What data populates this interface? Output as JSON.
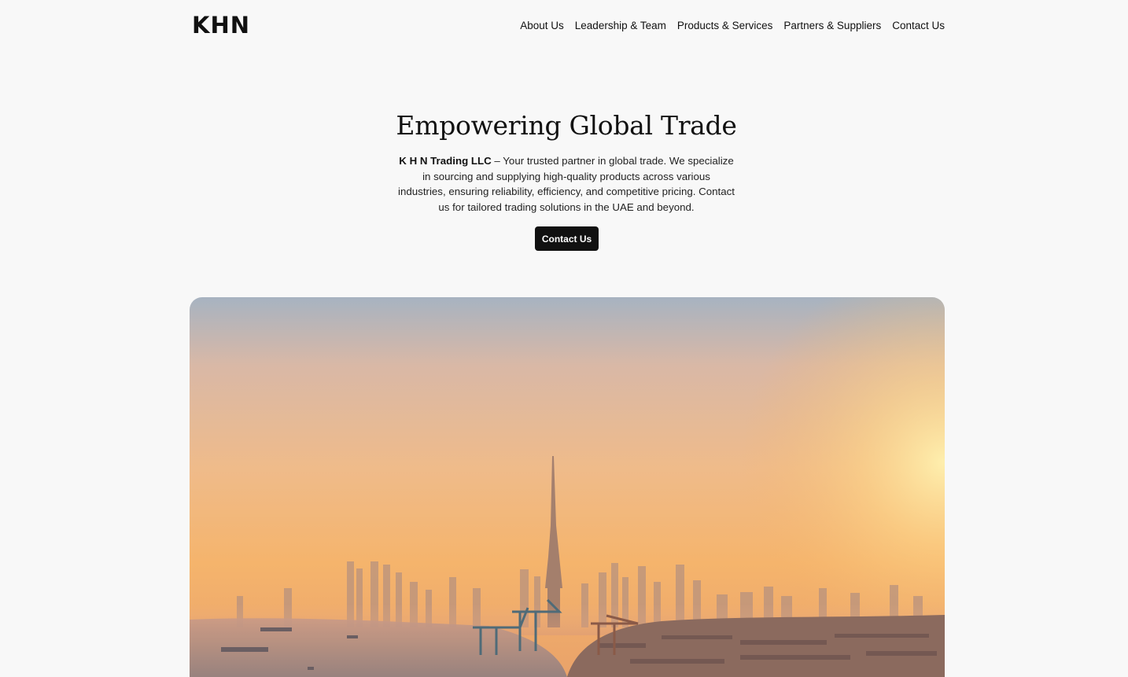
{
  "header": {
    "logo": "KHN",
    "nav": [
      {
        "label": "About Us"
      },
      {
        "label": "Leadership & Team"
      },
      {
        "label": "Products & Services"
      },
      {
        "label": "Partners & Suppliers"
      },
      {
        "label": "Contact Us"
      }
    ]
  },
  "hero": {
    "title": "Empowering Global Trade",
    "company": "K H N Trading LLC",
    "description": " – Your trusted partner in global trade. We specialize in sourcing and supplying high-quality products across various industries, ensuring reliability, efficiency, and competitive pricing. Contact us for tailored trading solutions in the UAE and beyond.",
    "cta_label": "Contact Us",
    "image_alt": "Dubai skyline at sunset with port cranes"
  },
  "colors": {
    "background": "#f8f8f8",
    "text": "#111111",
    "button": "#111111",
    "button_text": "#ffffff"
  }
}
